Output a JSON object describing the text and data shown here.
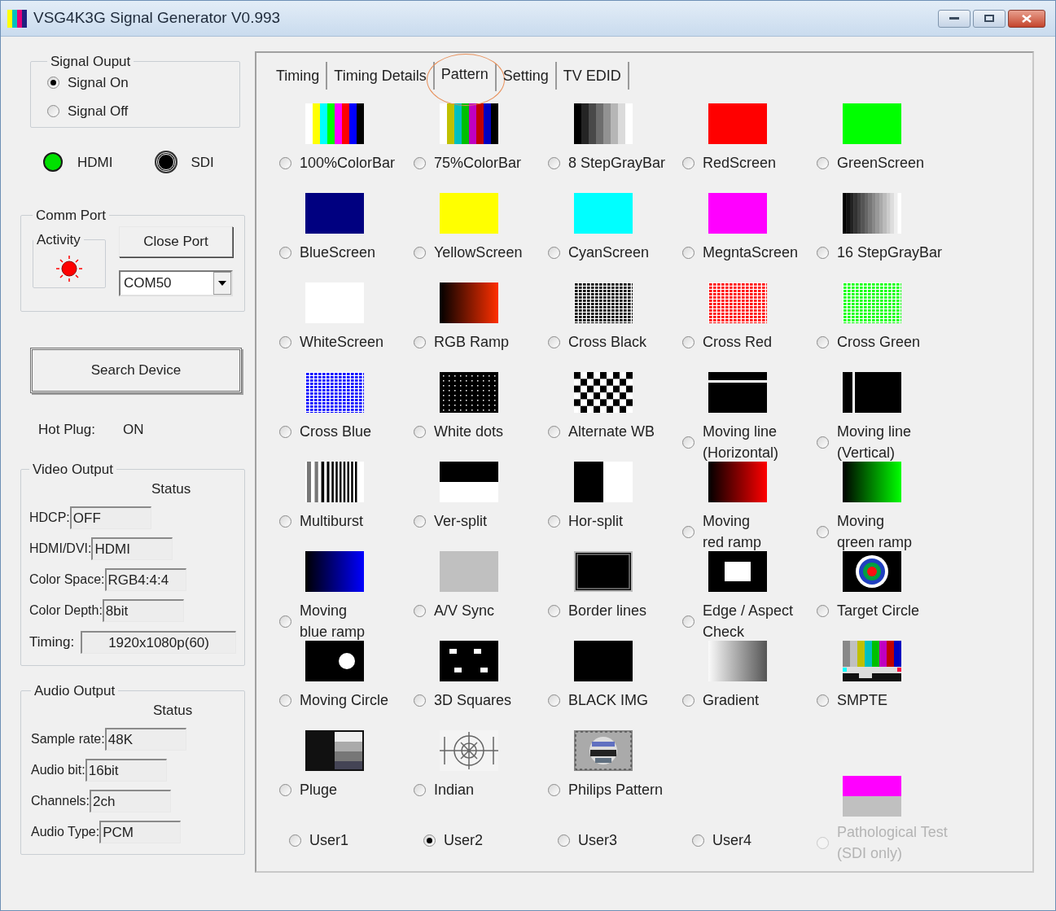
{
  "window": {
    "title": "VSG4K3G Signal Generator V0.993"
  },
  "signal_output": {
    "title": "Signal Ouput",
    "options": [
      {
        "label": "Signal On",
        "selected": true
      },
      {
        "label": "Signal Off",
        "selected": false
      }
    ]
  },
  "indicators": [
    {
      "label": "HDMI",
      "on": true
    },
    {
      "label": "SDI",
      "on": false
    }
  ],
  "comm_port": {
    "title": "Comm Port",
    "activity_title": "Activity",
    "activity_on": true,
    "close_button": "Close Port",
    "port": "COM50"
  },
  "search_button": "Search Device",
  "hot_plug": {
    "label": "Hot Plug:",
    "value": "ON"
  },
  "video_output": {
    "title": "Video Output",
    "status_header": "Status",
    "rows": [
      {
        "label": "HDCP:",
        "value": "OFF"
      },
      {
        "label": "HDMI/DVI:",
        "value": "HDMI"
      },
      {
        "label": "Color Space:",
        "value": "RGB4:4:4"
      },
      {
        "label": "Color Depth:",
        "value": "8bit"
      }
    ],
    "timing": {
      "label": "Timing:",
      "value": "1920x1080p(60)"
    }
  },
  "audio_output": {
    "title": "Audio Output",
    "status_header": "Status",
    "rows": [
      {
        "label": "Sample rate:",
        "value": "48K"
      },
      {
        "label": "Audio bit:",
        "value": "16bit"
      },
      {
        "label": "Channels:",
        "value": "2ch"
      },
      {
        "label": "Audio Type:",
        "value": "PCM"
      }
    ]
  },
  "tabs": [
    {
      "label": "Timing",
      "selected": false,
      "circled": false
    },
    {
      "label": "Timing Details",
      "selected": false,
      "circled": false
    },
    {
      "label": "Pattern",
      "selected": true,
      "circled": true
    },
    {
      "label": "Setting",
      "selected": false,
      "circled": false
    },
    {
      "label": "TV EDID",
      "selected": false,
      "circled": false
    }
  ],
  "patterns": [
    {
      "label": "100%ColorBar",
      "kind": "colorbar100",
      "selected": false
    },
    {
      "label": "75%ColorBar",
      "kind": "colorbar75",
      "selected": false
    },
    {
      "label": "8 StepGrayBar",
      "kind": "gray8",
      "selected": false
    },
    {
      "label": "RedScreen",
      "kind": "solid",
      "color": "#ff0000",
      "selected": false
    },
    {
      "label": "GreenScreen",
      "kind": "solid",
      "color": "#00ff00",
      "selected": false
    },
    {
      "label": "BlueScreen",
      "kind": "solid",
      "color": "#000080",
      "selected": false
    },
    {
      "label": "YellowScreen",
      "kind": "solid",
      "color": "#ffff00",
      "selected": false
    },
    {
      "label": "CyanScreen",
      "kind": "solid",
      "color": "#00ffff",
      "selected": false
    },
    {
      "label": "MegntaScreen",
      "kind": "solid",
      "color": "#ff00ff",
      "selected": false
    },
    {
      "label": "16 StepGrayBar",
      "kind": "gray16",
      "selected": false
    },
    {
      "label": "WhiteScreen",
      "kind": "solid",
      "color": "#ffffff",
      "selected": false
    },
    {
      "label": "RGB Ramp",
      "kind": "rgb_ramp",
      "selected": false
    },
    {
      "label": "Cross Black",
      "kind": "cross",
      "color": "#000000",
      "selected": false
    },
    {
      "label": "Cross Red",
      "kind": "cross",
      "color": "#ff0000",
      "selected": false
    },
    {
      "label": "Cross Green",
      "kind": "cross",
      "color": "#00ff00",
      "selected": false
    },
    {
      "label": "Cross Blue",
      "kind": "cross",
      "color": "#0000ff",
      "selected": false
    },
    {
      "label": "White dots",
      "kind": "dots",
      "selected": false
    },
    {
      "label": "Alternate WB",
      "kind": "checker",
      "selected": false
    },
    {
      "label": "Moving line\n(Horizontal)",
      "kind": "line_h",
      "selected": false
    },
    {
      "label": "Moving line\n(Vertical)",
      "kind": "line_v",
      "selected": false
    },
    {
      "label": "Multiburst",
      "kind": "multiburst",
      "selected": false
    },
    {
      "label": "Ver-split",
      "kind": "ver_split",
      "selected": false
    },
    {
      "label": "Hor-split",
      "kind": "hor_split",
      "selected": false
    },
    {
      "label": "Moving\nred ramp",
      "kind": "ramp_red",
      "selected": false
    },
    {
      "label": "Moving\nqreen ramp",
      "kind": "ramp_green",
      "selected": false
    },
    {
      "label": "Moving\nblue ramp",
      "kind": "ramp_blue",
      "selected": false
    },
    {
      "label": "A/V Sync",
      "kind": "gray_block",
      "selected": false
    },
    {
      "label": "Border lines",
      "kind": "border",
      "selected": false
    },
    {
      "label": "Edge / Aspect\nCheck",
      "kind": "edge",
      "selected": false
    },
    {
      "label": "Target Circle",
      "kind": "target",
      "selected": false
    },
    {
      "label": "Moving Circle",
      "kind": "circle",
      "selected": false
    },
    {
      "label": "3D Squares",
      "kind": "squares",
      "selected": false
    },
    {
      "label": "BLACK IMG",
      "kind": "black",
      "selected": false
    },
    {
      "label": "Gradient",
      "kind": "gradient",
      "selected": false
    },
    {
      "label": "SMPTE",
      "kind": "smpte",
      "selected": false
    },
    {
      "label": "Pluge",
      "kind": "pluge",
      "selected": false
    },
    {
      "label": "Indian",
      "kind": "indian",
      "selected": false
    },
    {
      "label": "Philips Pattern",
      "kind": "philips",
      "selected": false
    }
  ],
  "user_patterns": [
    {
      "label": "User1",
      "selected": false
    },
    {
      "label": "User2",
      "selected": true
    },
    {
      "label": "User3",
      "selected": false
    },
    {
      "label": "User4",
      "selected": false
    }
  ],
  "pathological_test": {
    "label": "Pathological Test\n(SDI only)",
    "kind": "pathological",
    "selected": false,
    "disabled": true
  }
}
